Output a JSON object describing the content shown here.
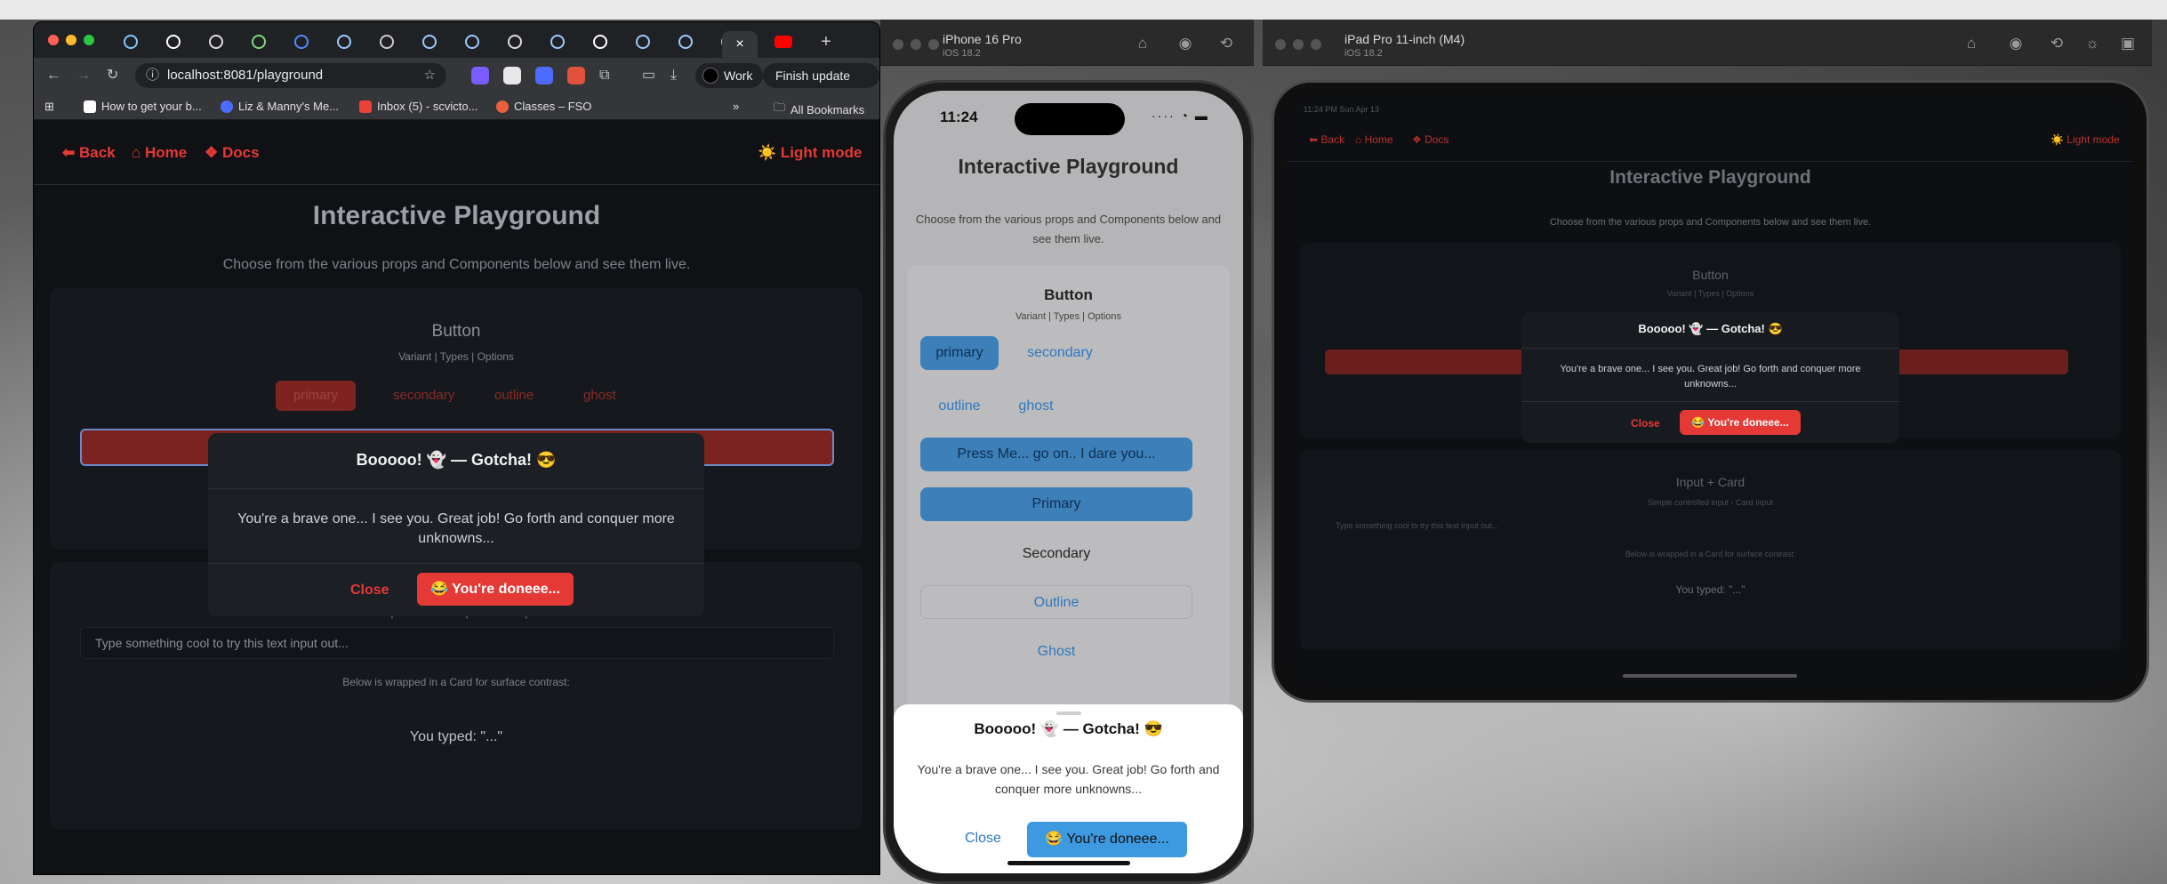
{
  "simulators": {
    "iphone": {
      "name": "iPhone 16 Pro",
      "os": "iOS 18.2"
    },
    "ipad": {
      "name": "iPad Pro 11-inch (M4)",
      "os": "iOS 18.2"
    }
  },
  "browser": {
    "url": "localhost:8081/playground",
    "profile": "Work",
    "update_label": "Finish update",
    "bookmarks": [
      "How to get your b...",
      "Liz & Manny's Me...",
      "Inbox (5) - scvicto...",
      "Classes – FSO"
    ],
    "all_bookmarks": "All Bookmarks",
    "more": "»"
  },
  "nav": {
    "back": "⬅ Back",
    "home": "⌂ Home",
    "docs": "❖ Docs",
    "light_mode": "☀️ Light mode"
  },
  "playground": {
    "title": "Interactive Playground",
    "subtitle": "Choose from the various props and Components below and see them live.",
    "button_section": {
      "title": "Button",
      "caption": "Variant | Types | Options",
      "variants": [
        "primary",
        "secondary",
        "outline",
        "ghost"
      ],
      "press_label": "Press Me... go on.. I dare you...",
      "primary": "Primary",
      "secondary": "Secondary",
      "outline": "Outline",
      "ghost": "Ghost"
    },
    "input_section": {
      "title": "Input + Card",
      "caption": "Simple controlled input - Card Input",
      "placeholder": "Type something cool to try this text input out...",
      "wrap_note": "Below is wrapped in a Card for surface contrast:",
      "typed": "You typed: \"...\""
    }
  },
  "modal": {
    "title": "Booooo! 👻 — Gotcha! 😎",
    "body": "You're a brave one... I see you. Great job! Go forth and conquer more unknowns...",
    "close": "Close",
    "confirm": "😂 You're doneee..."
  },
  "iphone_status": {
    "time": "11:24"
  },
  "ipad_status": {
    "time": "11:24 PM  Sun Apr 13"
  }
}
